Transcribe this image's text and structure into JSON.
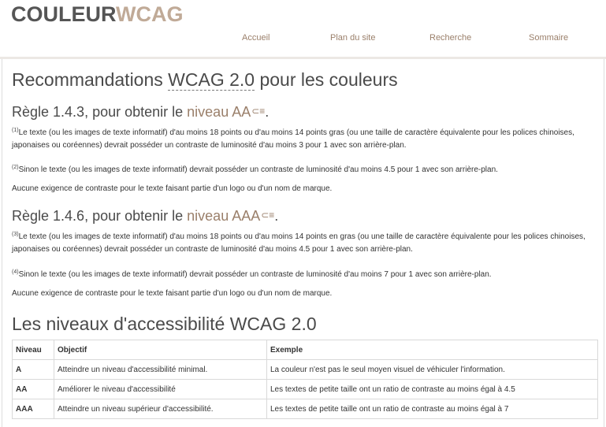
{
  "logo": {
    "part1": "COULEUR",
    "part2": "WCAG"
  },
  "nav": [
    "Accueil",
    "Plan du site",
    "Recherche",
    "Sommaire"
  ],
  "title": {
    "pre": "Recommandations ",
    "abbr": "WCAG 2.0",
    "post": " pour les couleurs"
  },
  "rule1": {
    "pre": "Règle 1.4.3, pour obtenir le ",
    "level": "niveau AA",
    "ext": "ᕦ",
    "dot": ".",
    "p1": {
      "note": "(1)",
      "text": "Le texte (ou les images de texte informatif) d'au moins 18 points ou d'au moins 14 points gras (ou une taille de caractère équivalente pour les polices chinoises, japonaises ou coréennes) devrait posséder un contraste de luminosité d'au moins 3 pour 1 avec son arrière-plan."
    },
    "p2": {
      "note": "(2)",
      "text": "Sinon le texte (ou les images de texte informatif) devrait posséder un contraste de luminosité d'au moins 4.5 pour 1 avec son arrière-plan."
    },
    "p3": "Aucune exigence de contraste pour le texte faisant partie d'un logo ou d'un nom de marque."
  },
  "rule2": {
    "pre": "Règle 1.4.6, pour obtenir le ",
    "level": "niveau AAA",
    "ext": "ᕦ",
    "dot": ".",
    "p1": {
      "note": "(3)",
      "text": "Le texte (ou les images de texte informatif) d'au moins 18 points ou d'au moins 14 points en gras (ou une taille de caractère équivalente pour les polices chinoises, japonaises ou coréennes) devrait posséder un contraste de luminosité d'au moins 4.5 pour 1 avec son arrière-plan."
    },
    "p2": {
      "note": "(4)",
      "text": "Sinon le texte (ou les images de texte informatif) devrait posséder un contraste de luminosité d'au moins 7 pour 1 avec son arrière-plan."
    },
    "p3": "Aucune exigence de contraste pour le texte faisant partie d'un logo ou d'un nom de marque."
  },
  "levels_title": "Les niveaux d'accessibilité WCAG 2.0",
  "table": {
    "headers": [
      "Niveau",
      "Objectif",
      "Exemple"
    ],
    "rows": [
      [
        "A",
        "Atteindre un niveau d'accessibilité minimal.",
        "La couleur n'est pas le seul moyen visuel de véhiculer l'information."
      ],
      [
        "AA",
        "Améliorer le niveau d'accessibilité",
        "Les textes de petite taille ont un ratio de contraste au moins égal à 4.5"
      ],
      [
        "AAA",
        "Atteindre un niveau supérieur d'accessibilité.",
        "Les textes de petite taille ont un ratio de contraste au moins égal à 7"
      ]
    ]
  }
}
